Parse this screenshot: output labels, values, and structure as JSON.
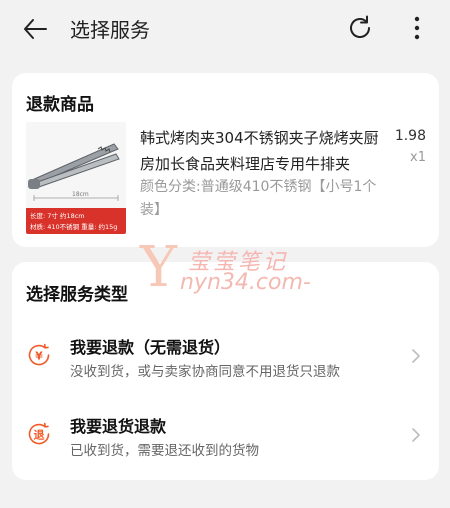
{
  "header": {
    "title": "选择服务",
    "back_icon": "arrow-left-icon",
    "refresh_icon": "refresh-icon",
    "more_icon": "more-vertical-icon"
  },
  "refund_item": {
    "section_title": "退款商品",
    "product": {
      "name": "韩式烤肉夹304不锈钢夹子烧烤夹厨房加长食品夹料理店专用牛排夹",
      "spec": "颜色分类:普通级410不锈钢【小号1个装】",
      "price": "1.98",
      "quantity": "x1",
      "image_caption_length": "长度: 7寸  约18cm",
      "image_caption_material": "材质: 410不锈钢   重量: 约15g",
      "image_ruler_label": "18cm"
    }
  },
  "service": {
    "section_title": "选择服务类型",
    "options": [
      {
        "title": "我要退款（无需退货）",
        "desc": "没收到货，或与卖家协商同意不用退货只退款",
        "icon": "yuan-refund-icon",
        "icon_text": "¥"
      },
      {
        "title": "我要退货退款",
        "desc": "已收到货，需要退还收到的货物",
        "icon": "return-goods-icon",
        "icon_text": "退"
      }
    ]
  },
  "watermark": {
    "letter": "Y",
    "chinese": "莹莹笔记",
    "url": "nyn34.com-"
  },
  "colors": {
    "accent": "#f05a28",
    "background": "#f2f2f2",
    "card": "#ffffff"
  }
}
